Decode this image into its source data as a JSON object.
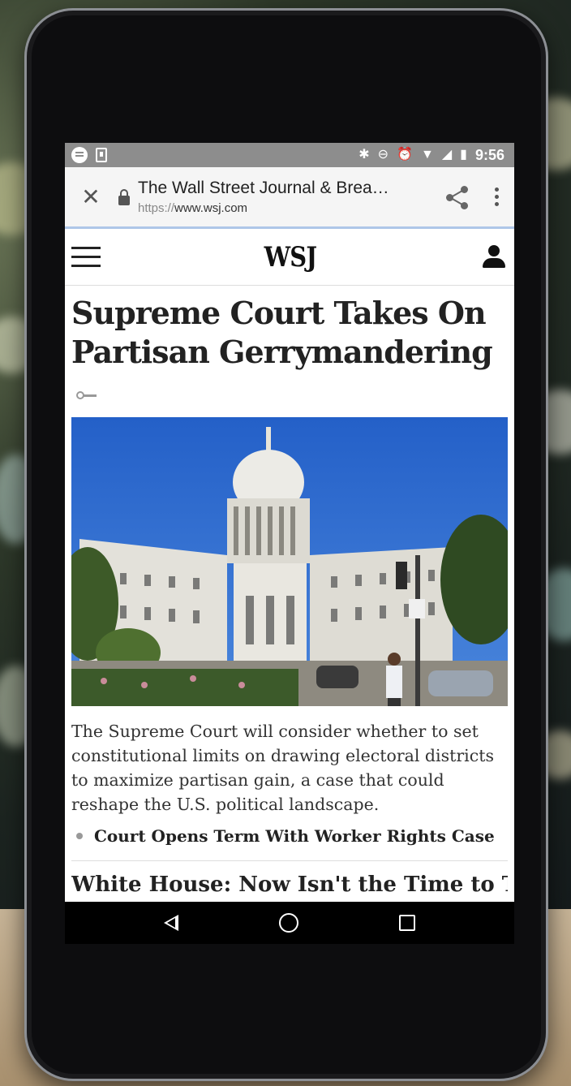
{
  "status_bar": {
    "time": "9:56",
    "left_icons": [
      "spotify-icon",
      "download-icon"
    ],
    "right_icons": [
      "bluetooth-icon",
      "do-not-disturb-icon",
      "alarm-icon",
      "wifi-icon",
      "signal-icon",
      "battery-icon"
    ]
  },
  "browser": {
    "page_title": "The Wall Street Journal & Brea…",
    "url_scheme": "https://",
    "url_host": "www.wsj.com",
    "close_icon": "close-icon",
    "share_icon": "share-icon",
    "menu_icon": "more-vert-icon"
  },
  "site": {
    "logo": "WSJ"
  },
  "article": {
    "headline": "Supreme Court Takes On Partisan Gerrymandering",
    "summary": "The Supreme Court will consider whether to set constitutional limits on drawing electoral districts to maximize partisan gain, a case that could reshape the U.S. political landscape.",
    "related_link": "Court Opens Term With Worker Rights Case",
    "next_headline": "White House: Now Isn't the Time to Talk"
  },
  "colors": {
    "status_bar_bg": "#8d8d8d",
    "url_bar_bg": "#f5f5f5",
    "url_underline": "#aec6e8",
    "sky": "#2f6fd0"
  }
}
